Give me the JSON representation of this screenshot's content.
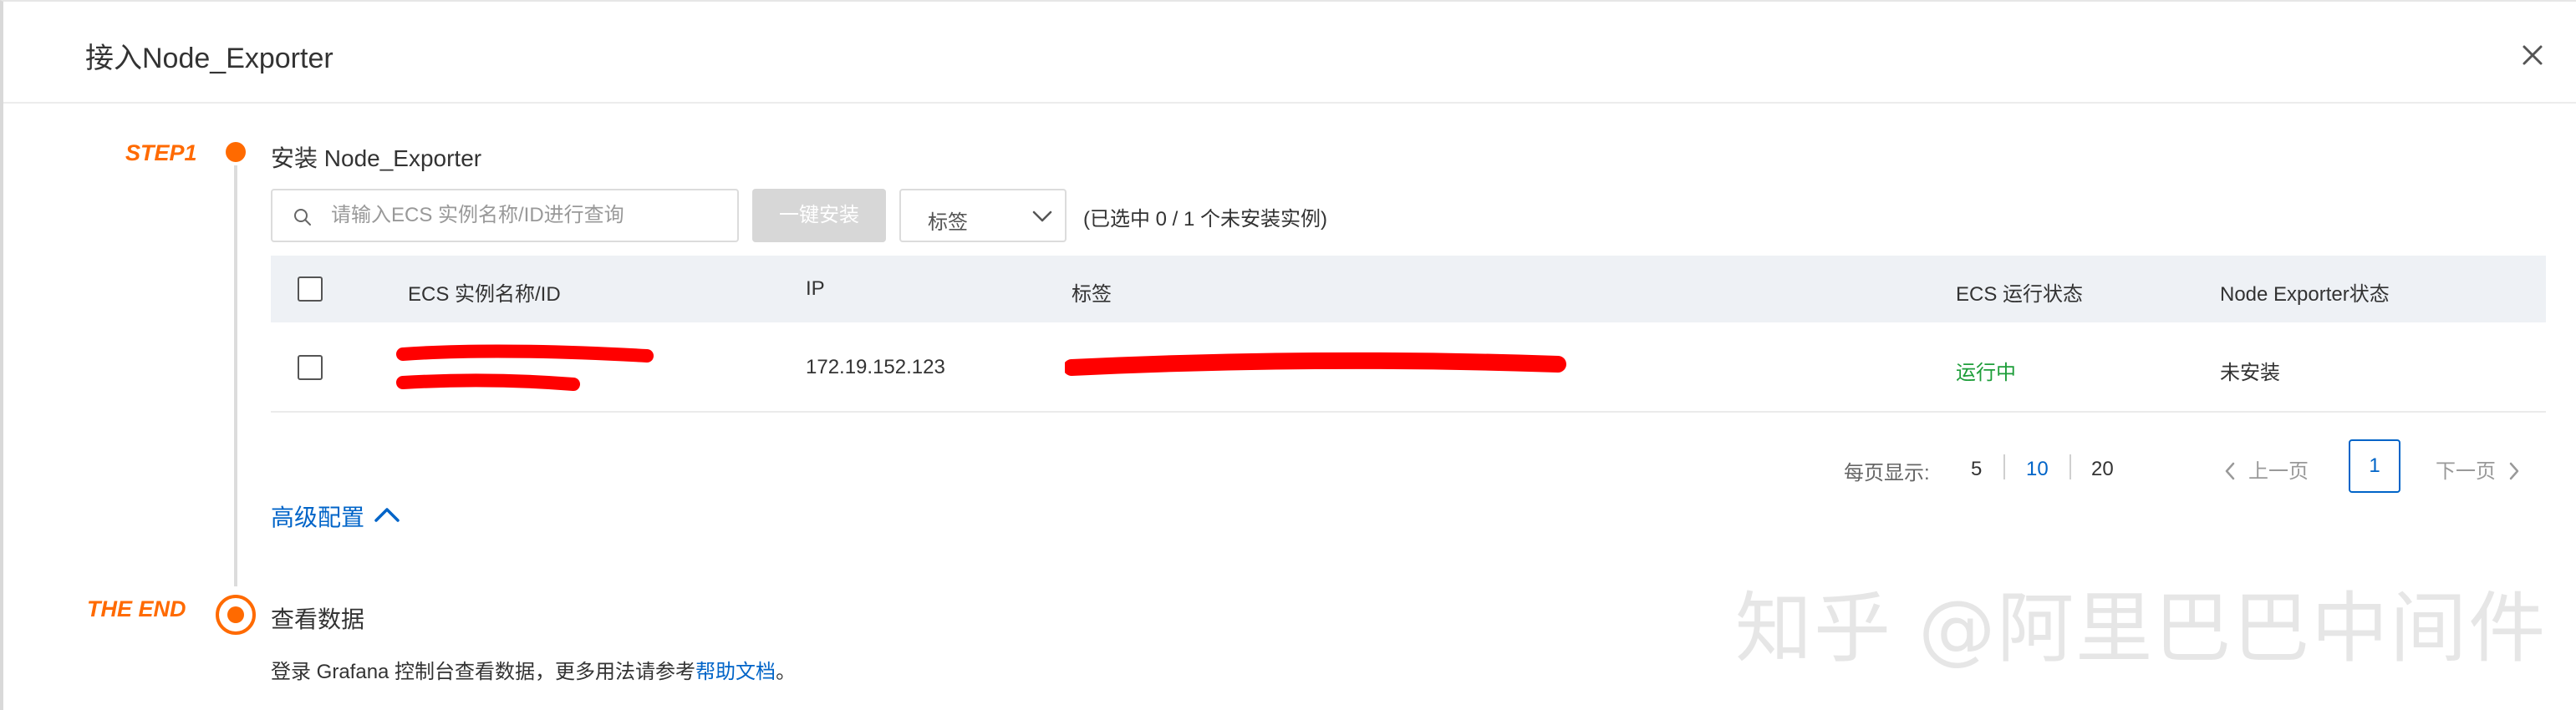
{
  "dialog": {
    "title": "接入Node_Exporter"
  },
  "step1": {
    "label": "STEP1",
    "title": "安装 Node_Exporter",
    "search": {
      "placeholder": "请输入ECS 实例名称/ID进行查询",
      "value": ""
    },
    "install_button": "一键安装",
    "tag_select": {
      "label": "标签"
    },
    "selection_status": "(已选中 0 / 1 个未安装实例)",
    "table": {
      "columns": [
        "ECS 实例名称/ID",
        "IP",
        "标签",
        "ECS 运行状态",
        "Node Exporter状态"
      ],
      "rows": [
        {
          "name": "",
          "ip": "172.19.152.123",
          "tags": "",
          "ecs_status": "运行中",
          "exporter_status": "未安装"
        }
      ]
    },
    "pagination": {
      "page_size_label": "每页显示:",
      "page_sizes": [
        "5",
        "10",
        "20"
      ],
      "active_page_size": "10",
      "prev": "上一页",
      "next": "下一页",
      "current_page": "1"
    },
    "advanced": "高级配置"
  },
  "end": {
    "label": "THE END",
    "title": "查看数据",
    "desc_prefix": "登录 Grafana 控制台查看数据，更多用法请参考",
    "help_link": "帮助文档",
    "desc_suffix": "。"
  },
  "watermark": "知乎 @阿里巴巴中间件",
  "colors": {
    "accent": "#ff6a00",
    "link": "#0064c8",
    "running": "#1e9e3a",
    "redaction": "#ff0000"
  }
}
